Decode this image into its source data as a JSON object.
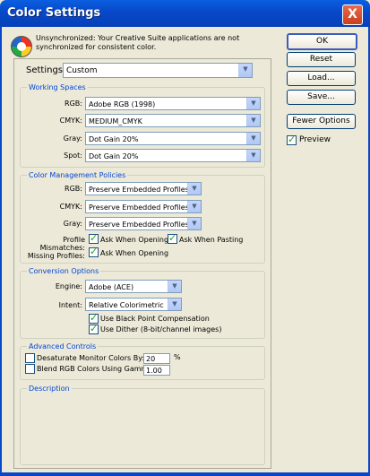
{
  "window": {
    "title": "Color Settings",
    "close": "X"
  },
  "warning": "Unsynchronized: Your Creative Suite applications are not synchronized for consistent color.",
  "buttons": {
    "ok": "OK",
    "reset": "Reset",
    "load": "Load...",
    "save": "Save...",
    "fewer": "Fewer Options",
    "preview": "Preview"
  },
  "settings": {
    "label": "Settings:",
    "value": "Custom"
  },
  "working_spaces": {
    "title": "Working Spaces",
    "rgb_label": "RGB:",
    "rgb": "Adobe RGB (1998)",
    "cmyk_label": "CMYK:",
    "cmyk": "MEDIUM_CMYK",
    "gray_label": "Gray:",
    "gray": "Dot Gain 20%",
    "spot_label": "Spot:",
    "spot": "Dot Gain 20%"
  },
  "policies": {
    "title": "Color Management Policies",
    "rgb_label": "RGB:",
    "rgb": "Preserve Embedded Profiles",
    "cmyk_label": "CMYK:",
    "cmyk": "Preserve Embedded Profiles",
    "gray_label": "Gray:",
    "gray": "Preserve Embedded Profiles",
    "mismatch_label": "Profile Mismatches:",
    "ask_open": "Ask When Opening",
    "ask_paste": "Ask When Pasting",
    "missing_label": "Missing Profiles:",
    "ask_open2": "Ask When Opening"
  },
  "conversion": {
    "title": "Conversion Options",
    "engine_label": "Engine:",
    "engine": "Adobe (ACE)",
    "intent_label": "Intent:",
    "intent": "Relative Colorimetric",
    "bpc": "Use Black Point Compensation",
    "dither": "Use Dither (8-bit/channel images)"
  },
  "advanced": {
    "title": "Advanced Controls",
    "desat": "Desaturate Monitor Colors By:",
    "desat_value": "20",
    "desat_unit": "%",
    "blend": "Blend RGB Colors Using Gamma:",
    "blend_value": "1.00"
  },
  "description": {
    "title": "Description"
  }
}
